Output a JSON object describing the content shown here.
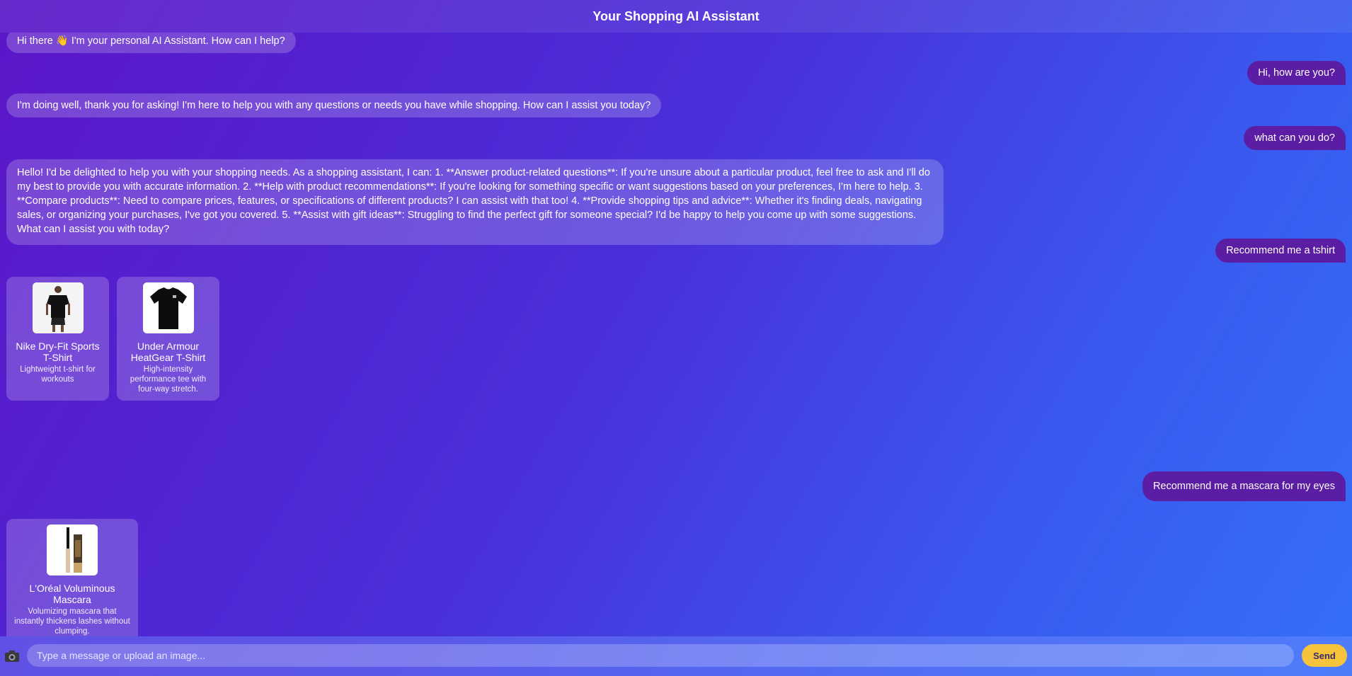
{
  "header": {
    "title": "Your Shopping AI Assistant"
  },
  "messages": [
    {
      "role": "bot",
      "text": "Hi there 👋 I'm your personal AI Assistant. How can I help?"
    },
    {
      "role": "user",
      "text": "Hi, how are you?"
    },
    {
      "role": "bot",
      "text": "I'm doing well, thank you for asking! I'm here to help you with any questions or needs you have while shopping. How can I assist you today?"
    },
    {
      "role": "user",
      "text": "what can you do?"
    },
    {
      "role": "bot",
      "text": "Hello! I'd be delighted to help you with your shopping needs. As a shopping assistant, I can: 1. **Answer product-related questions**: If you're unsure about a particular product, feel free to ask and I'll do my best to provide you with accurate information. 2. **Help with product recommendations**: If you're looking for something specific or want suggestions based on your preferences, I'm here to help. 3. **Compare products**: Need to compare prices, features, or specifications of different products? I can assist with that too! 4. **Provide shopping tips and advice**: Whether it's finding deals, navigating sales, or organizing your purchases, I've got you covered. 5. **Assist with gift ideas**: Struggling to find the perfect gift for someone special? I'd be happy to help you come up with some suggestions. What can I assist you with today?"
    },
    {
      "role": "user",
      "text": "Recommend me a tshirt"
    },
    {
      "role": "user",
      "text": "Recommend me a mascara for my eyes"
    }
  ],
  "product_groups": [
    {
      "products": [
        {
          "name": "Nike Dry-Fit Sports T-Shirt",
          "description": "Lightweight t-shirt for workouts",
          "icon": "woman-in-black-tshirt"
        },
        {
          "name": "Under Armour HeatGear T-Shirt",
          "description": "High-intensity performance tee with four-way stretch.",
          "icon": "black-tshirt"
        }
      ]
    },
    {
      "products": [
        {
          "name": "L'Oréal Voluminous Mascara",
          "description": "Volumizing mascara that instantly thickens lashes without clumping.",
          "icon": "mascara-tube"
        }
      ]
    }
  ],
  "composer": {
    "placeholder": "Type a message or upload an image...",
    "send_label": "Send",
    "camera_icon": "camera-icon"
  },
  "colors": {
    "user_bubble": "#5b1da3",
    "send_button": "#f7c33a"
  }
}
